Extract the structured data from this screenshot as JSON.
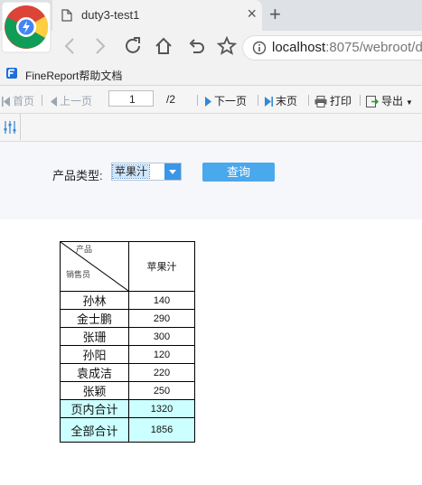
{
  "browser": {
    "tab_title": "duty3-test1",
    "url_host": "localhost",
    "url_path": ":8075/webroot/d",
    "bookmark_label": "FineReport帮助文档"
  },
  "toolbar": {
    "first": "首页",
    "prev": "上一页",
    "page_value": "1",
    "page_total": "/2",
    "next": "下一页",
    "last": "末页",
    "print": "打印",
    "export": "导出"
  },
  "params": {
    "label": "产品类型:",
    "selected": "苹果汁",
    "query": "查询"
  },
  "report": {
    "header_top": "产品",
    "header_bottom": "销售员",
    "product": "苹果汁",
    "rows": [
      {
        "name": "孙林",
        "value": "140"
      },
      {
        "name": "金士鹏",
        "value": "290"
      },
      {
        "name": "张珊",
        "value": "300"
      },
      {
        "name": "孙阳",
        "value": "120"
      },
      {
        "name": "袁成洁",
        "value": "220"
      },
      {
        "name": "张颖",
        "value": "250"
      }
    ],
    "page_total_label": "页内合计",
    "page_total_value": "1320",
    "grand_total_label": "全部合计",
    "grand_total_value": "1856"
  },
  "colors": {
    "accent": "#4aa8ec",
    "total_bg": "#ccffff",
    "page_total_text": "#e02020"
  }
}
